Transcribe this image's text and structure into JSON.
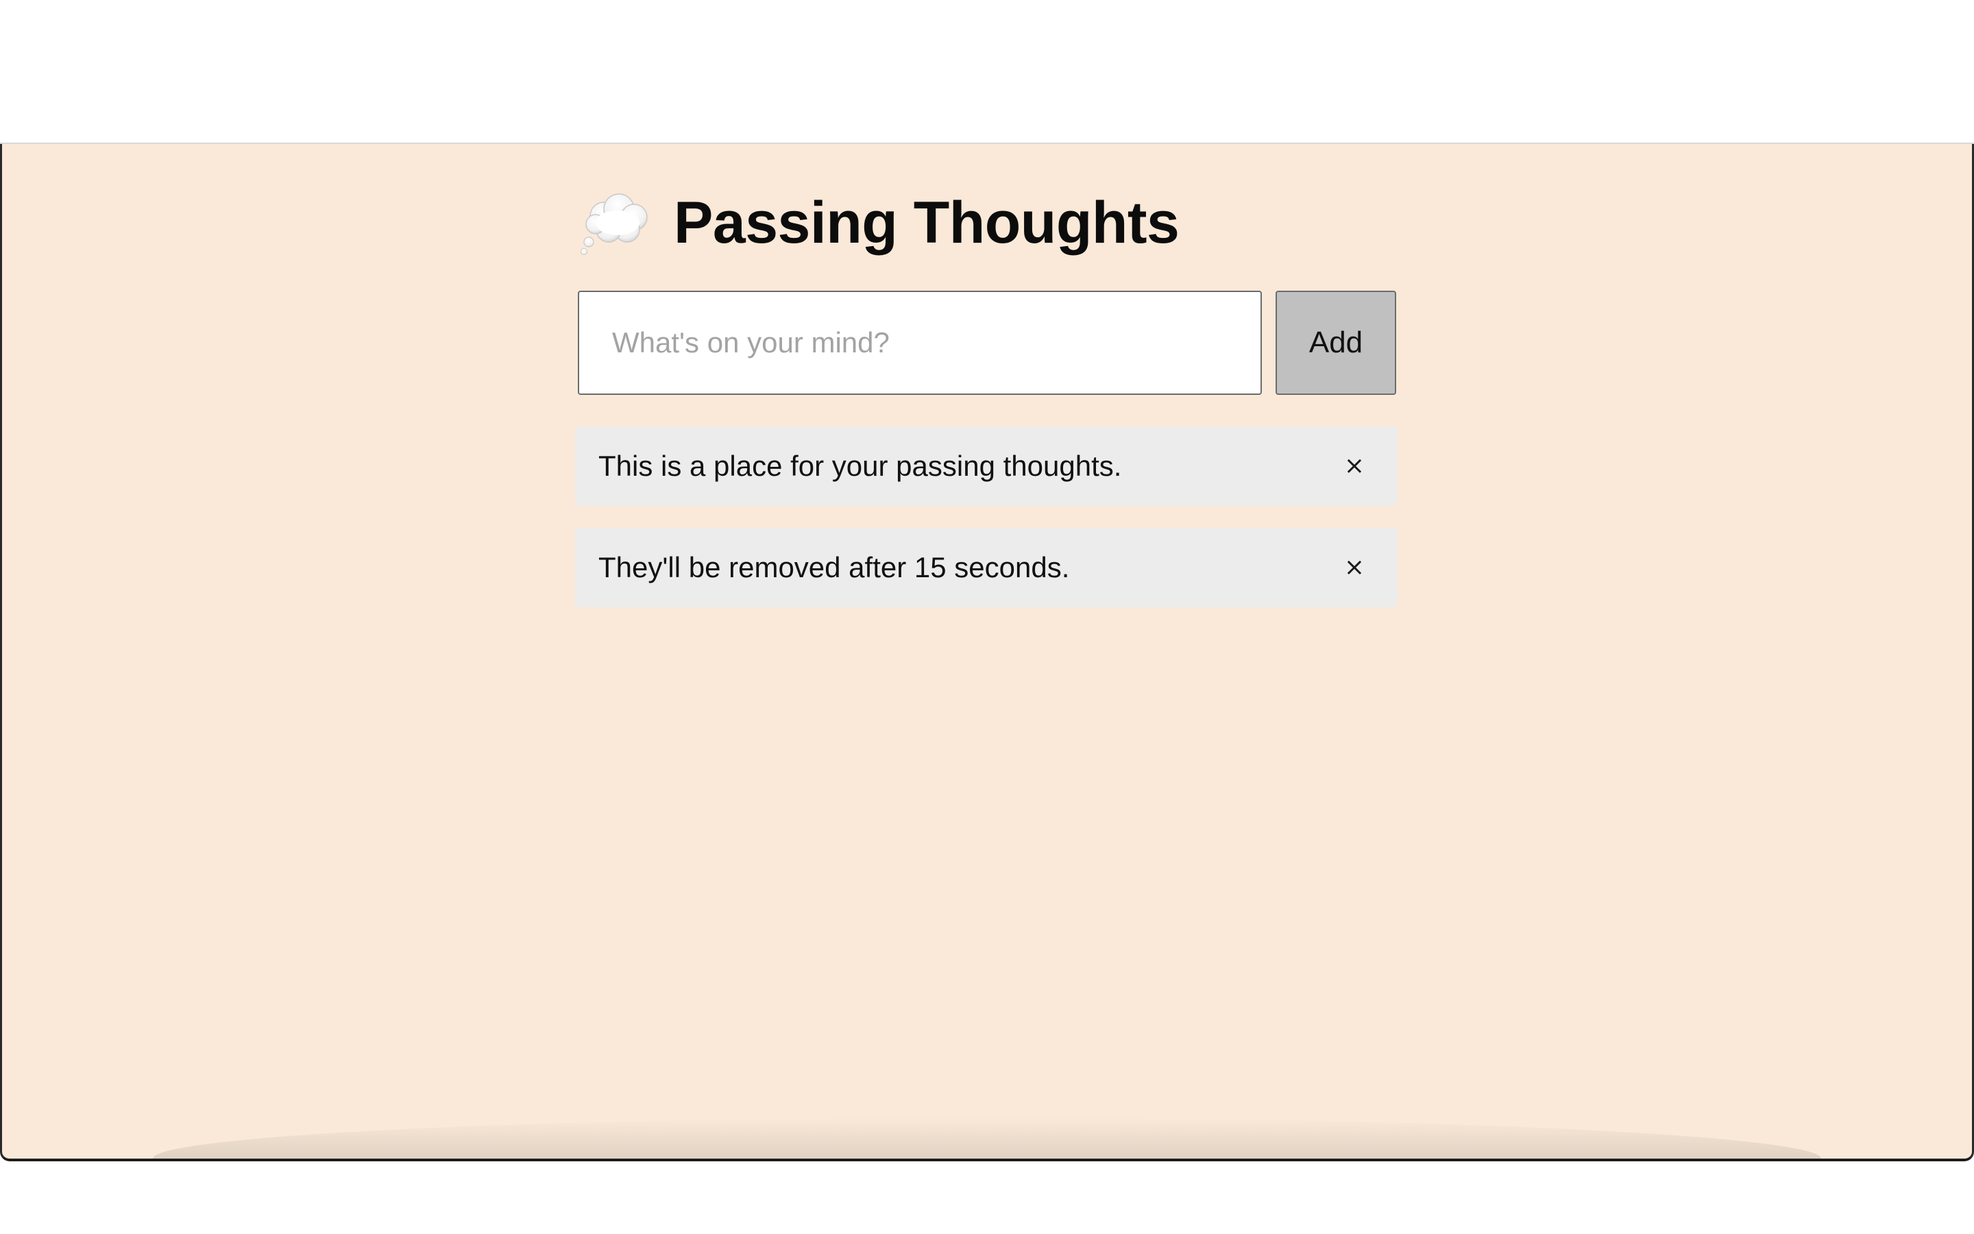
{
  "app": {
    "title": "Passing Thoughts",
    "icon": "thought-balloon-icon"
  },
  "form": {
    "input_value": "",
    "input_placeholder": "What's on your mind?",
    "add_label": "Add"
  },
  "thoughts": [
    {
      "text": "This is a place for your passing thoughts.",
      "remove_label": "×"
    },
    {
      "text": "They'll be removed after 15 seconds.",
      "remove_label": "×"
    }
  ],
  "colors": {
    "background": "#fae9d8",
    "card": "#ececec",
    "button": "#c0c0c0"
  }
}
